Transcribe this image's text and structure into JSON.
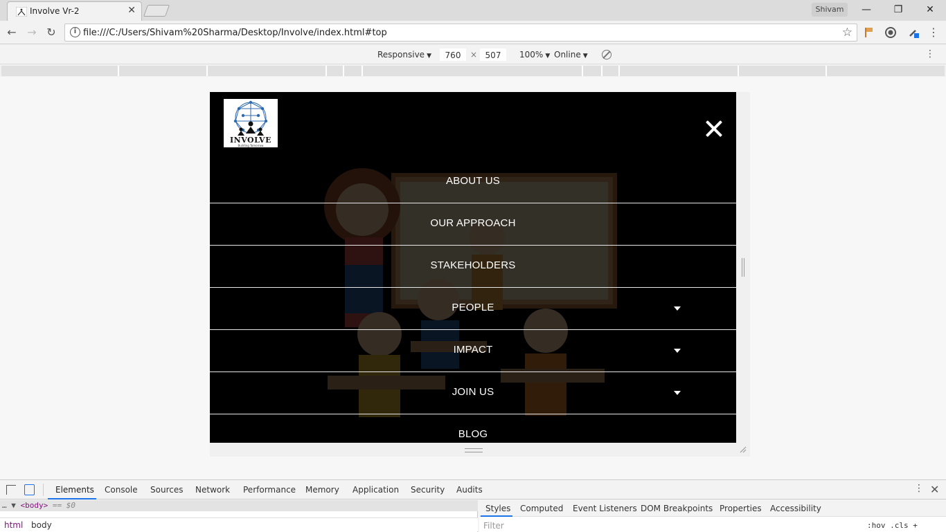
{
  "browser": {
    "tab_title": "Involve Vr-2",
    "tab_close": "✕",
    "user_name": "Shivam",
    "window_controls": {
      "minimize": "—",
      "restore": "❐",
      "close": "✕"
    },
    "nav": {
      "back": "←",
      "forward": "→",
      "reload": "↻"
    },
    "url": "file:///C:/Users/Shivam%20Sharma/Desktop/Involve/index.html#top",
    "info_icon": "i",
    "bookmark_icon": "☆"
  },
  "device_toolbar": {
    "mode": "Responsive",
    "width": "760",
    "times": "×",
    "height": "507",
    "zoom": "100%",
    "network": "Online",
    "caret": "▼",
    "more": "⋮"
  },
  "site": {
    "logo_text": "INVOLVE",
    "logo_tagline": "Building Tomorrow",
    "menu": [
      {
        "label": "ABOUT US",
        "has_dropdown": false
      },
      {
        "label": "OUR APPROACH",
        "has_dropdown": false
      },
      {
        "label": "STAKEHOLDERS",
        "has_dropdown": false
      },
      {
        "label": "PEOPLE",
        "has_dropdown": true
      },
      {
        "label": "IMPACT",
        "has_dropdown": true
      },
      {
        "label": "JOIN US",
        "has_dropdown": true
      },
      {
        "label": "BLOG",
        "has_dropdown": false
      }
    ]
  },
  "devtools": {
    "tabs": [
      "Elements",
      "Console",
      "Sources",
      "Network",
      "Performance",
      "Memory",
      "Application",
      "Security",
      "Audits"
    ],
    "active_tab": "Elements",
    "dom_selected": "<body>",
    "dom_eq": "== $0",
    "dom_prefix": "… ▼",
    "breadcrumbs": [
      "html",
      "body"
    ],
    "styles_tabs": [
      "Styles",
      "Computed",
      "Event Listeners",
      "DOM Breakpoints",
      "Properties",
      "Accessibility"
    ],
    "active_styles_tab": "Styles",
    "filter_placeholder": "Filter",
    "styles_tools": ":hov  .cls  +",
    "more": "⋮",
    "close": "✕"
  },
  "colors": {
    "accent": "#1a73e8",
    "menu_bg": "#000000",
    "menu_text": "#ffffff"
  }
}
